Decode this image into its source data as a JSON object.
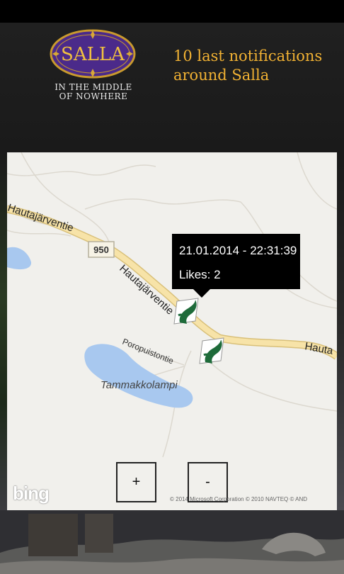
{
  "logo": {
    "brand": "SALLA",
    "tagline_line1": "IN THE MIDDLE",
    "tagline_line2": "OF NOWHERE"
  },
  "header": {
    "title_line1": "10 last notifications",
    "title_line2": "around Salla"
  },
  "map": {
    "road_number": "950",
    "labels": {
      "road_a": "Hautajärventie",
      "road_b": "Hautajärventie",
      "road_c": "Hauta",
      "path": "Poropuistontie",
      "lake": "Tammakkolampi"
    },
    "tooltip": {
      "timestamp": "21.01.2014 - 22:31:39",
      "likes": "Likes: 2"
    },
    "zoom_in_label": "+",
    "zoom_out_label": "-",
    "provider": "bing",
    "copyright": "© 2014 Microsoft Corporation   © 2010 NAVTEQ   © AND"
  },
  "colors": {
    "accent": "#f2b233",
    "logo_purple": "#4b2a8a",
    "road": "#f7e3a8",
    "water": "#a8c8ef",
    "pin_green": "#1e6b3a"
  }
}
